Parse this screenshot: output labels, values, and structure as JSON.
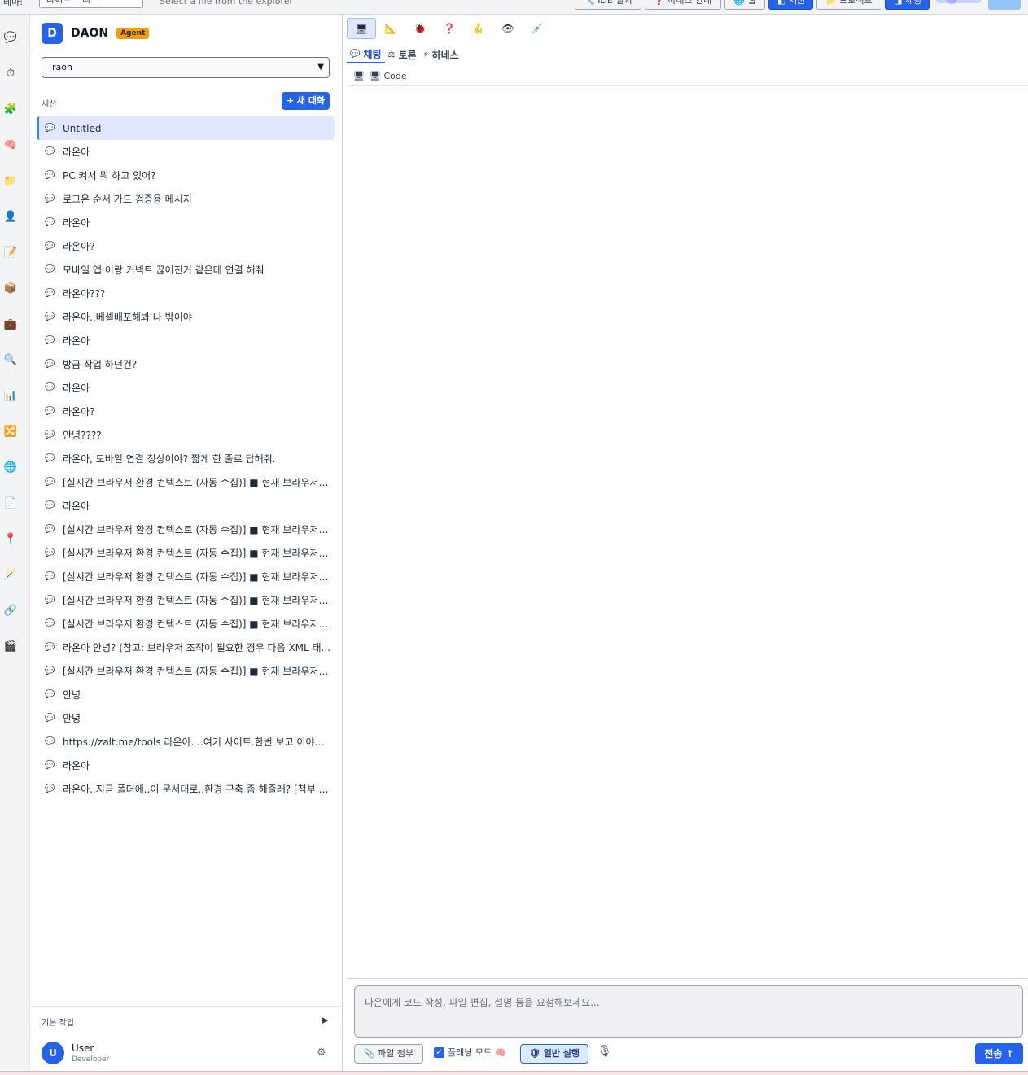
{
  "topbar": {
    "theme_label": "테마:",
    "theme_value": "다이트 브리즈",
    "file_hint": "Select a file from the explorer",
    "buttons": [
      {
        "label": "🔧 IDE 열기",
        "style": "light"
      },
      {
        "label": "❓ 하네스 안내",
        "style": "light"
      },
      {
        "label": "🌐 웹",
        "style": "light"
      },
      {
        "label": "◧ 세션",
        "style": "blue"
      },
      {
        "label": "📁 프로젝트",
        "style": "light"
      },
      {
        "label": "◨ 채팅",
        "style": "blue"
      }
    ]
  },
  "rail": {
    "icons": [
      {
        "name": "chat-icon",
        "glyph": "💬"
      },
      {
        "name": "timer-icon",
        "glyph": "⏱"
      },
      {
        "name": "puzzle-icon",
        "glyph": "🧩"
      },
      {
        "name": "brain-icon",
        "glyph": "🧠"
      },
      {
        "name": "folder-icon",
        "glyph": "📁"
      },
      {
        "name": "user-icon",
        "glyph": "👤"
      },
      {
        "name": "memo-icon",
        "glyph": "📝"
      },
      {
        "name": "package-icon",
        "glyph": "📦"
      },
      {
        "name": "briefcase-icon",
        "glyph": "💼"
      },
      {
        "name": "search-icon",
        "glyph": "🔍"
      },
      {
        "name": "chart-icon",
        "glyph": "📊"
      },
      {
        "name": "shuffle-icon",
        "glyph": "🔀"
      },
      {
        "name": "globe-icon",
        "glyph": "🌐"
      },
      {
        "name": "document-icon",
        "glyph": "📄"
      },
      {
        "name": "pin-icon",
        "glyph": "📍"
      },
      {
        "name": "wand-icon",
        "glyph": "🪄"
      },
      {
        "name": "link-icon",
        "glyph": "🔗"
      },
      {
        "name": "clapper-icon",
        "glyph": "🎬"
      }
    ]
  },
  "sidebar": {
    "brand_letter": "D",
    "brand_name": "DAON",
    "brand_badge": "Agent",
    "agent_select": "raon",
    "sessions_label": "세션",
    "new_chat": "+ 새 대화",
    "sessions": [
      "Untitled",
      "라온아",
      "PC 켜서 뭐 하고 있어?",
      "로그온 순서 가드 검증용 메시지",
      "라온아",
      "라온아?",
      "모바일 앱 이랑 커넥트 끊어진거 같은데 연결 해줘",
      "라온아???",
      "라온아..베셀배포해봐 나 밖이야",
      "라온아",
      "방금 작업 하던건?",
      "라온아",
      "라온아?",
      "안녕????",
      "라온아, 모바일 연결 정상이야? 짧게 한 줄로 답해줘.",
      "[실시간 브라우저 환경 컨텍스트 (자동 수집)] ■ 현재 브라우저에...",
      "라온아",
      "[실시간 브라우저 환경 컨텍스트 (자동 수집)] ■ 현재 브라우저에...",
      "[실시간 브라우저 환경 컨텍스트 (자동 수집)] ■ 현재 브라우저에...",
      "[실시간 브라우저 환경 컨텍스트 (자동 수집)] ■ 현재 브라우저에...",
      "[실시간 브라우저 환경 컨텍스트 (자동 수집)] ■ 현재 브라우저에...",
      "[실시간 브라우저 환경 컨텍스트 (자동 수집)] ■ 현재 브라우저에...",
      "라온아 안녕? (참고: 브라우저 조작이 필요한 경우 다음 XML 태...",
      "[실시간 브라우저 환경 컨텍스트 (자동 수집)] ■ 현재 브라우저에...",
      "안녕",
      "안녕",
      "https://zalt.me/tools 라온아. ..여기 사이트.한번 보고 이야기해봐",
      "라온아",
      "라온아..지금 폴더에..이 문서대로..환경 구축 좀 해줄래? [첨부 파..."
    ],
    "basic_tasks_label": "기본 작업",
    "user": {
      "initial": "U",
      "name": "User",
      "role": "Developer"
    }
  },
  "main": {
    "tools": [
      {
        "name": "monitor-icon",
        "glyph": "🖥"
      },
      {
        "name": "blueprint-icon",
        "glyph": "📐"
      },
      {
        "name": "bug-icon",
        "glyph": "🐞"
      },
      {
        "name": "question-icon",
        "glyph": "❓"
      },
      {
        "name": "hook-icon",
        "glyph": "🪝"
      },
      {
        "name": "eye-icon",
        "glyph": "👁"
      },
      {
        "name": "syringe-icon",
        "glyph": "💉"
      }
    ],
    "mode_tabs": [
      {
        "icon": "💬",
        "label": "채팅",
        "active": true
      },
      {
        "icon": "⚖",
        "label": "토론",
        "active": false
      },
      {
        "icon": "⚡",
        "label": "하네스",
        "active": false
      }
    ],
    "file_tab": "Code",
    "composer_placeholder": "다온에게 코드 작성, 파일 편집, 설명 등을 요청해보세요...",
    "attach_label": "📎 파일 첨부",
    "planning_label": "플래닝 모드",
    "run_mode_label": "일반 실행",
    "send_label": "전송 ↑"
  }
}
